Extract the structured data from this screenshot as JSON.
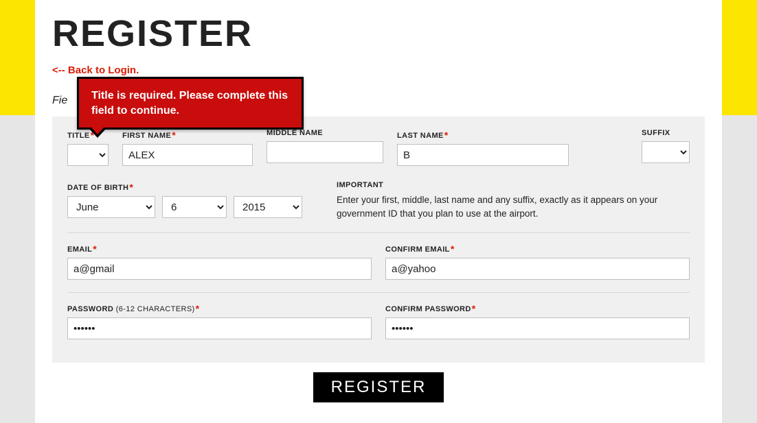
{
  "page": {
    "heading": "REGISTER",
    "back_link": "<-- Back to Login.",
    "caption_prefix": "Fie",
    "submit_label": "REGISTER"
  },
  "error": {
    "title_required": "Title is required. Please complete this field to continue."
  },
  "labels": {
    "title": "TITLE",
    "first_name": "FIRST NAME",
    "middle_name": "MIDDLE NAME",
    "last_name": "LAST NAME",
    "suffix": "SUFFIX",
    "dob": "DATE OF BIRTH",
    "email": "EMAIL",
    "confirm_email": "CONFIRM EMAIL",
    "password": "PASSWORD",
    "password_sub": " (6-12 CHARACTERS)",
    "confirm_password": "CONFIRM PASSWORD",
    "important_head": "IMPORTANT",
    "important_body": "Enter your first, middle, last name and any suffix, exactly as it appears on your government ID that you plan to use at the airport."
  },
  "values": {
    "title": "",
    "first_name": "ALEX",
    "middle_name": "",
    "last_name": "B",
    "suffix": "",
    "dob_month": "June",
    "dob_day": "6",
    "dob_year": "2015",
    "email": "a@gmail",
    "confirm_email": "a@yahoo",
    "password": "••••••",
    "confirm_password": "••••••"
  }
}
